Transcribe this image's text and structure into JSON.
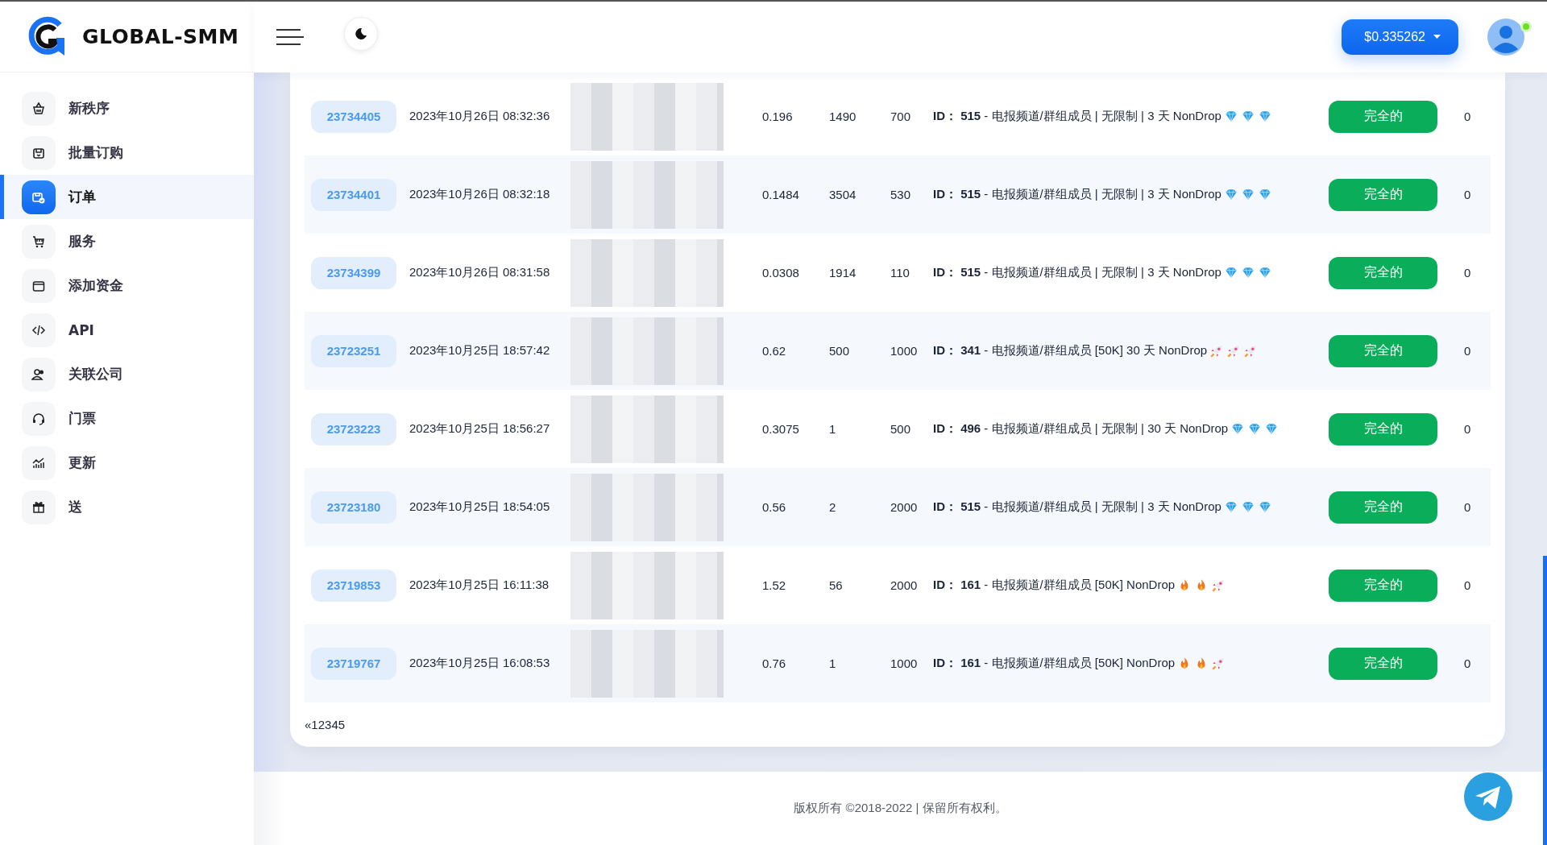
{
  "brand": {
    "name": "GLOBAL-SMM"
  },
  "header": {
    "balance": "$0.335262",
    "avatar_online": true
  },
  "sidebar": {
    "items": [
      {
        "label": "新秩序",
        "selected": false
      },
      {
        "label": "批量订购",
        "selected": false
      },
      {
        "label": "订单",
        "selected": true
      },
      {
        "label": "服务",
        "selected": false
      },
      {
        "label": "添加资金",
        "selected": false
      },
      {
        "label": "API",
        "selected": false
      },
      {
        "label": "关联公司",
        "selected": false
      },
      {
        "label": "门票",
        "selected": false
      },
      {
        "label": "更新",
        "selected": false
      },
      {
        "label": "送",
        "selected": false
      }
    ]
  },
  "orders": {
    "rows": [
      {
        "id": "23734405",
        "date": "2023年10月26日 08:32:36",
        "charge": "0.196",
        "start_count": "1490",
        "quantity": "700",
        "service": "**ID： 515** - 电报频道/群组成员 | 无限制 | 3 天 NonDrop",
        "marks": [
          {
            "kind": "diamond"
          },
          {
            "kind": "diamond"
          },
          {
            "kind": "diamond"
          }
        ],
        "status": "完全的",
        "remains": "0"
      },
      {
        "id": "23734401",
        "date": "2023年10月26日 08:32:18",
        "charge": "0.1484",
        "start_count": "3504",
        "quantity": "530",
        "service": "**ID： 515** - 电报频道/群组成员 | 无限制 | 3 天 NonDrop",
        "marks": [
          {
            "kind": "diamond"
          },
          {
            "kind": "diamond"
          },
          {
            "kind": "diamond"
          }
        ],
        "status": "完全的",
        "remains": "0"
      },
      {
        "id": "23734399",
        "date": "2023年10月26日 08:31:58",
        "charge": "0.0308",
        "start_count": "1914",
        "quantity": "110",
        "service": "**ID： 515** - 电报频道/群组成员 | 无限制 | 3 天 NonDrop",
        "marks": [
          {
            "kind": "diamond"
          },
          {
            "kind": "diamond"
          },
          {
            "kind": "diamond"
          }
        ],
        "status": "完全的",
        "remains": "0"
      },
      {
        "id": "23723251",
        "date": "2023年10月25日 18:57:42",
        "charge": "0.62",
        "start_count": "500",
        "quantity": "1000",
        "service": "**ID： 341** - 电报频道/群组成员 [50K] 30 天 NonDrop",
        "marks": [
          {
            "kind": "rocket"
          },
          {
            "kind": "rocket"
          },
          {
            "kind": "rocket"
          }
        ],
        "status": "完全的",
        "remains": "0"
      },
      {
        "id": "23723223",
        "date": "2023年10月25日 18:56:27",
        "charge": "0.3075",
        "start_count": "1",
        "quantity": "500",
        "service": "**ID： 496** - 电报频道/群组成员 | 无限制 | 30 天 NonDrop",
        "marks": [
          {
            "kind": "diamond"
          },
          {
            "kind": "diamond"
          },
          {
            "kind": "diamond"
          }
        ],
        "status": "完全的",
        "remains": "0"
      },
      {
        "id": "23723180",
        "date": "2023年10月25日 18:54:05",
        "charge": "0.56",
        "start_count": "2",
        "quantity": "2000",
        "service": "**ID： 515** - 电报频道/群组成员 | 无限制 | 3 天 NonDrop",
        "marks": [
          {
            "kind": "diamond"
          },
          {
            "kind": "diamond"
          },
          {
            "kind": "diamond"
          }
        ],
        "status": "完全的",
        "remains": "0"
      },
      {
        "id": "23719853",
        "date": "2023年10月25日 16:11:38",
        "charge": "1.52",
        "start_count": "56",
        "quantity": "2000",
        "service": "**ID： 161** - 电报频道/群组成员 [50K] NonDrop",
        "marks": [
          {
            "kind": "flame"
          },
          {
            "kind": "flame"
          },
          {
            "kind": "rocket"
          }
        ],
        "status": "完全的",
        "remains": "0"
      },
      {
        "id": "23719767",
        "date": "2023年10月25日 16:08:53",
        "charge": "0.76",
        "start_count": "1",
        "quantity": "1000",
        "service": "**ID： 161** - 电报频道/群组成员 [50K] NonDrop",
        "marks": [
          {
            "kind": "flame"
          },
          {
            "kind": "flame"
          },
          {
            "kind": "rocket"
          }
        ],
        "status": "完全的",
        "remains": "0"
      }
    ],
    "pagination": [
      "«",
      "1",
      "2",
      "3",
      "4",
      "5"
    ]
  },
  "footer": {
    "copyright": "版权所有 ©2018-2022 | 保留所有权利。"
  }
}
